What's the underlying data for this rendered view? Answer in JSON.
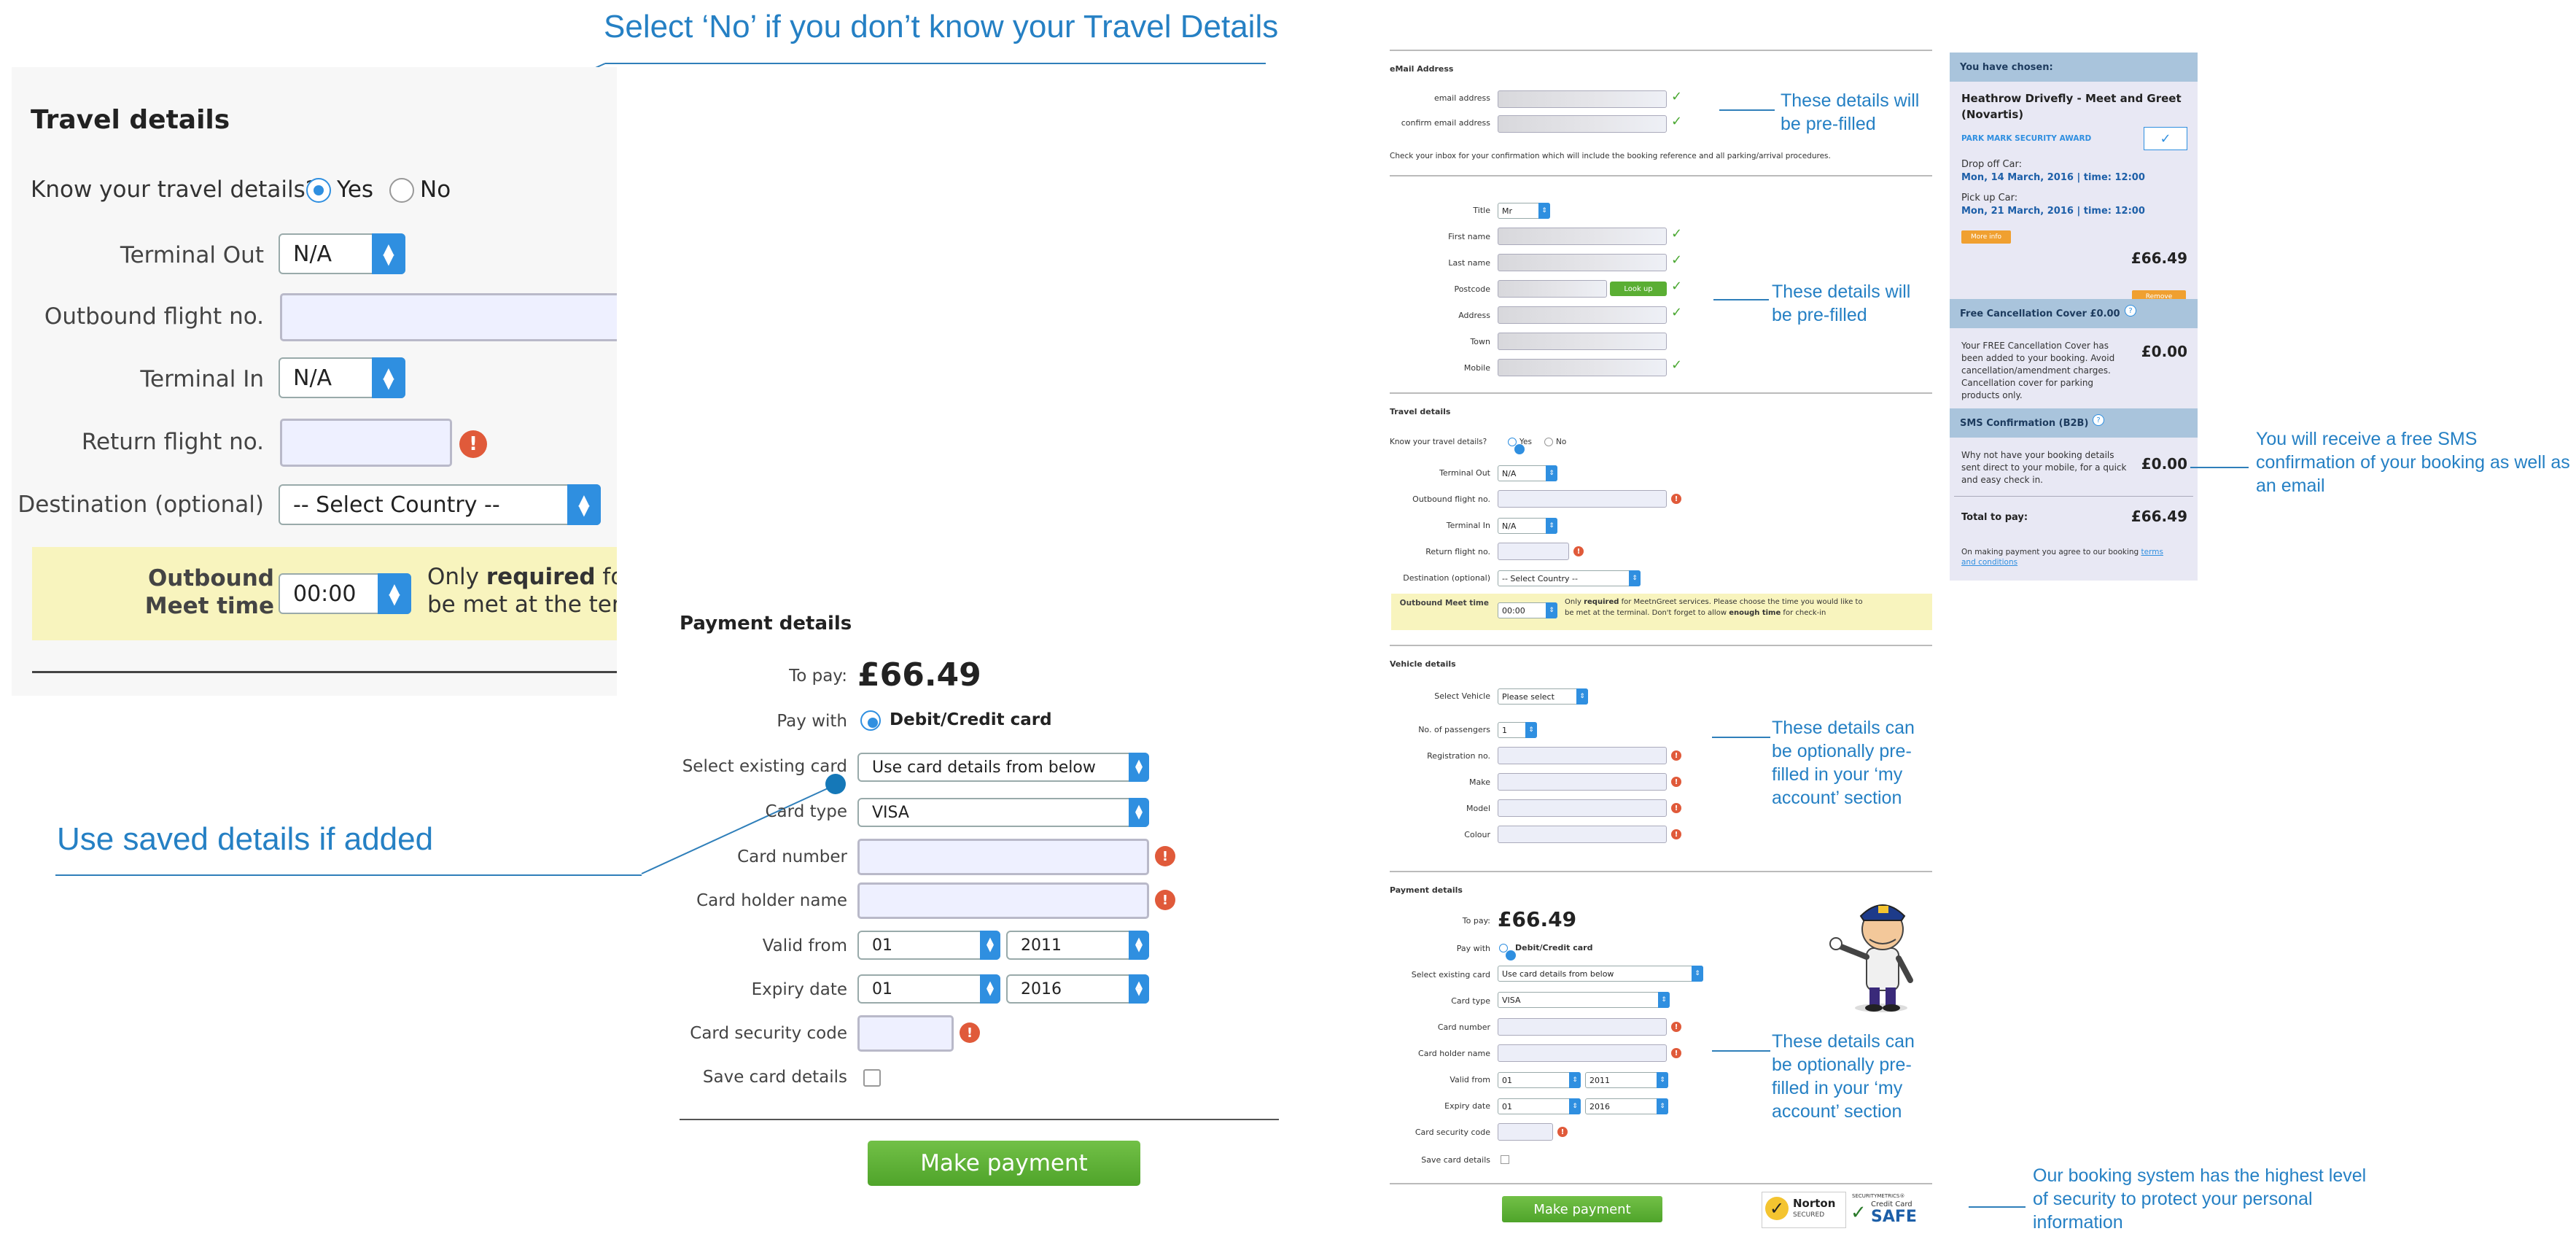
{
  "annotations": {
    "travel_no": "Select ‘No’ if you don’t know your Travel Details",
    "saved_details": "Use saved details if added",
    "prefilled_email": "These details will be pre-filled",
    "prefilled_personal": "These details will be pre-filled",
    "vehicle_optional": "These details can be optionally pre-filled in your ‘my account’ section",
    "payment_optional": "These details can be optionally pre-filled in your ‘my account’ section",
    "sms": "You will receive a free SMS confirmation of your booking as well as an email",
    "security": "Our booking system has the highest level of security to protect your personal information"
  },
  "zoom_travel": {
    "title": "Travel details",
    "know_label": "Know your travel details?",
    "yes": "Yes",
    "no": "No",
    "terminal_out_label": "Terminal Out",
    "terminal_out_value": "N/A",
    "outbound_flight_label": "Outbound flight no.",
    "terminal_in_label": "Terminal In",
    "terminal_in_value": "N/A",
    "return_flight_label": "Return flight no.",
    "destination_label": "Destination (optional)",
    "destination_value": "-- Select Country --",
    "meet_label": "Outbound Meet time",
    "meet_value": "00:00",
    "meet_text_a": "Only ",
    "meet_text_b": "required",
    "meet_text_c": " for",
    "meet_text_d": "be met at the term"
  },
  "zoom_payment": {
    "title": "Payment details",
    "to_pay_label": "To pay:",
    "to_pay_value": "£66.49",
    "pay_with_label": "Pay with",
    "pay_with_value": "Debit/Credit card",
    "select_card_label": "Select existing card",
    "select_card_value": "Use card details from below",
    "card_type_label": "Card type",
    "card_type_value": "VISA",
    "card_number_label": "Card number",
    "holder_label": "Card holder name",
    "valid_from_label": "Valid from",
    "valid_from_month": "01",
    "valid_from_year": "2011",
    "expiry_label": "Expiry date",
    "expiry_month": "01",
    "expiry_year": "2016",
    "security_label": "Card security code",
    "save_label": "Save card details",
    "button": "Make payment"
  },
  "page": {
    "email_title": "eMail Address",
    "email_label": "email address",
    "confirm_email_label": "confirm email address",
    "email_note": "Check your inbox for your confirmation which will include the booking reference and all parking/arrival procedures.",
    "title_label": "Title",
    "title_value": "Mr",
    "first_name": "First name",
    "last_name": "Last name",
    "postcode": "Postcode",
    "lookup": "Look up",
    "address": "Address",
    "town": "Town",
    "mobile": "Mobile",
    "travel_title": "Travel details",
    "know_label": "Know your travel details?",
    "yes": "Yes",
    "no": "No",
    "terminal_out": "Terminal Out",
    "terminal_out_value": "N/A",
    "outbound_flight": "Outbound flight no.",
    "terminal_in": "Terminal In",
    "terminal_in_value": "N/A",
    "return_flight": "Return flight no.",
    "destination": "Destination (optional)",
    "destination_value": "-- Select Country --",
    "meet_label": "Outbound Meet time",
    "meet_value": "00:00",
    "meet_text_a": "Only ",
    "meet_text_b": "required",
    "meet_text_c": " for MeetnGreet services. Please choose the time you would like to",
    "meet_text_d": "be met at the terminal. Don't forget to allow ",
    "meet_text_e": "enough time",
    "meet_text_f": " for check-in",
    "vehicle_title": "Vehicle details",
    "select_vehicle": "Select Vehicle",
    "select_vehicle_value": "Please select",
    "passengers": "No. of passengers",
    "passengers_value": "1",
    "registration": "Registration no.",
    "make": "Make",
    "model": "Model",
    "colour": "Colour",
    "payment_title": "Payment details",
    "to_pay_label": "To pay:",
    "to_pay_value": "£66.49",
    "pay_with_label": "Pay with",
    "pay_with_value": "Debit/Credit card",
    "select_card_label": "Select existing card",
    "select_card_value": "Use card details from below",
    "card_type_label": "Card type",
    "card_type_value": "VISA",
    "card_number_label": "Card number",
    "holder_label": "Card holder name",
    "valid_from_label": "Valid from",
    "valid_from_month": "01",
    "valid_from_year": "2011",
    "expiry_label": "Expiry date",
    "expiry_month": "01",
    "expiry_year": "2016",
    "security_label": "Card security code",
    "save_label": "Save card details",
    "button": "Make payment",
    "norton_a": "Norton",
    "norton_b": "SECURED",
    "sm_a": "SECURITYMETRICS®",
    "sm_b": "Credit Card",
    "sm_c": "SAFE"
  },
  "sidebar": {
    "chosen_title": "You have chosen:",
    "product": "Heathrow Drivefly - Meet and Greet (Novartis)",
    "award": "PARK MARK SECURITY AWARD",
    "dropoff_label": "Drop off Car:",
    "dropoff_value": "Mon, 14 March, 2016 | time: 12:00",
    "pickup_label": "Pick up Car:",
    "pickup_value": "Mon, 21 March, 2016 | time: 12:00",
    "more_info": "More info",
    "price": "£66.49",
    "remove": "Remove",
    "cancel_title": "Free Cancellation Cover £0.00",
    "cancel_text": "Your FREE Cancellation Cover has been added to your booking. Avoid cancellation/amendment charges. Cancellation cover for parking products only.",
    "cancel_price": "£0.00",
    "sms_title": "SMS Confirmation (B2B)",
    "sms_text": "Why not have your booking details sent direct to your mobile, for a quick and easy check in.",
    "sms_price": "£0.00",
    "total_label": "Total to pay:",
    "total_value": "£66.49",
    "terms_a": "On making payment you agree to our booking ",
    "terms_b": "terms and conditions"
  },
  "colors": {
    "accent_blue": "#2f8fe0",
    "annotation_blue": "#2580c4",
    "green_button": "#5aae33",
    "error_red": "#e05a3a",
    "sidebar_head": "#a9c4dc",
    "highlight_yellow": "#f8f4be"
  }
}
